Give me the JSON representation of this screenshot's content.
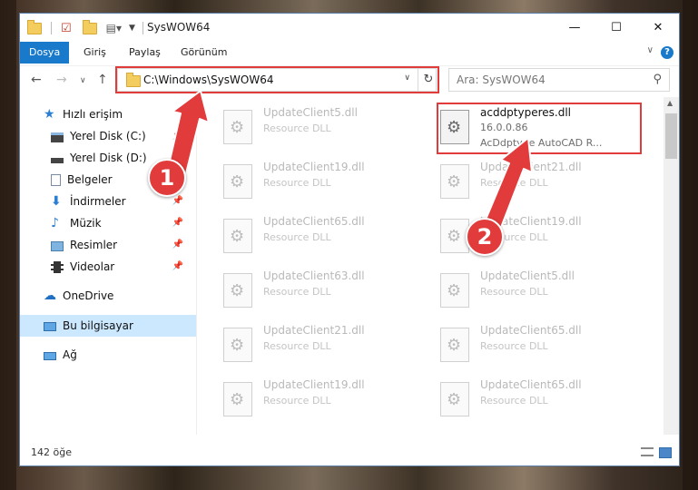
{
  "window": {
    "title": "SysWOW64",
    "minimize": "—",
    "maximize": "☐",
    "close": "✕"
  },
  "ribbon": {
    "tabs": [
      "Dosya",
      "Giriş",
      "Paylaş",
      "Görünüm"
    ],
    "help": "?"
  },
  "nav": {
    "address": "C:\\Windows\\SysWOW64",
    "search_placeholder": "Ara: SysWOW64"
  },
  "sidebar": {
    "items": [
      {
        "label": "Hızlı erişim",
        "icon": "star-icon"
      },
      {
        "label": "Yerel Disk (C:)",
        "icon": "drive-icon",
        "pinned": true
      },
      {
        "label": "Yerel Disk (D:)",
        "icon": "drive-icon",
        "pinned": true
      },
      {
        "label": "Belgeler",
        "icon": "documents-icon",
        "pinned": true
      },
      {
        "label": "İndirmeler",
        "icon": "download-icon",
        "pinned": true
      },
      {
        "label": "Müzik",
        "icon": "music-icon",
        "pinned": true
      },
      {
        "label": "Resimler",
        "icon": "pictures-icon",
        "pinned": true
      },
      {
        "label": "Videolar",
        "icon": "videos-icon",
        "pinned": true
      },
      {
        "label": "OneDrive",
        "icon": "cloud-icon"
      },
      {
        "label": "Bu bilgisayar",
        "icon": "computer-icon",
        "selected": true
      },
      {
        "label": "Ağ",
        "icon": "network-icon"
      }
    ]
  },
  "files": {
    "highlighted": {
      "name": "acddptyperes.dll",
      "version": "16.0.0.86",
      "type": "AcDdptype AutoCAD R..."
    },
    "left_column": [
      {
        "name": "UpdateClient5.dll",
        "type": "Resource DLL"
      },
      {
        "name": "UpdateClient19.dll",
        "type": "Resource DLL"
      },
      {
        "name": "UpdateClient65.dll",
        "type": "Resource DLL"
      },
      {
        "name": "UpdateClient63.dll",
        "type": "Resource DLL"
      },
      {
        "name": "UpdateClient21.dll",
        "type": "Resource DLL"
      },
      {
        "name": "UpdateClient19.dll",
        "type": "Resource DLL"
      }
    ],
    "right_column": [
      {
        "name": "UpdateClient21.dll",
        "type": "Resource DLL"
      },
      {
        "name": "UpdateClient19.dll",
        "type": "Resource DLL"
      },
      {
        "name": "UpdateClient5.dll",
        "type": "Resource DLL"
      },
      {
        "name": "UpdateClient65.dll",
        "type": "Resource DLL"
      },
      {
        "name": "UpdateClient65.dll",
        "type": "Resource DLL"
      }
    ]
  },
  "status": {
    "item_count": "142 öğe"
  },
  "annotations": {
    "step1": "1",
    "step2": "2",
    "color": "#e23b3b"
  }
}
